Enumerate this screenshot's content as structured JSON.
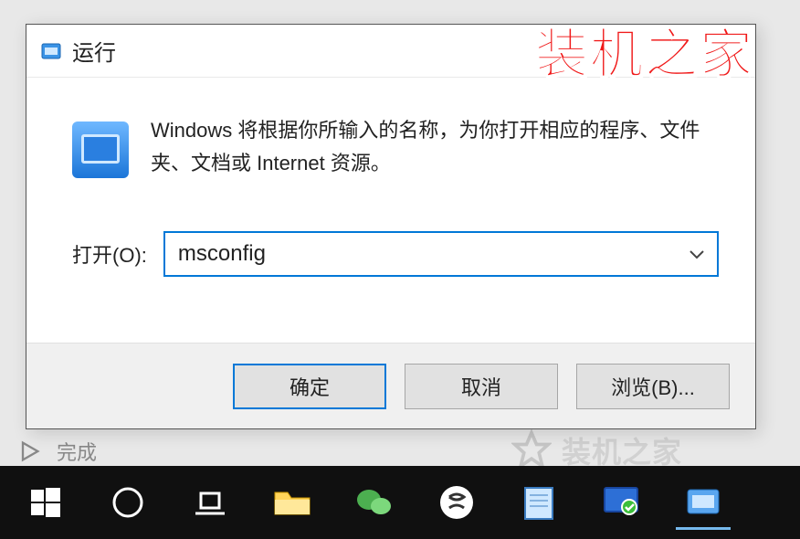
{
  "watermark": "装机之家",
  "dialog": {
    "title": "运行",
    "close_label": "✕",
    "description": "Windows 将根据你所输入的名称，为你打开相应的程序、文件夹、文档或 Internet 资源。",
    "open_label": "打开(O):",
    "input_value": "msconfig",
    "buttons": {
      "ok": "确定",
      "cancel": "取消",
      "browse": "浏览(B)..."
    }
  },
  "background": {
    "done": "完成",
    "faded_wm": "装机之家"
  }
}
